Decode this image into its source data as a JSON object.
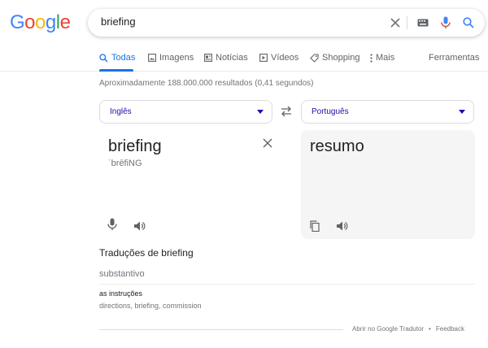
{
  "logo": {
    "letters": [
      "G",
      "o",
      "o",
      "g",
      "l",
      "e"
    ],
    "colors": [
      "#4285F4",
      "#EA4335",
      "#FBBC05",
      "#4285F4",
      "#34A853",
      "#EA4335"
    ]
  },
  "search": {
    "query": "briefing"
  },
  "tabs": [
    {
      "label": "Todas",
      "icon": "search-icon",
      "active": true
    },
    {
      "label": "Imagens",
      "icon": "image-icon",
      "active": false
    },
    {
      "label": "Notícias",
      "icon": "news-icon",
      "active": false
    },
    {
      "label": "Vídeos",
      "icon": "video-icon",
      "active": false
    },
    {
      "label": "Shopping",
      "icon": "tag-icon",
      "active": false
    },
    {
      "label": "Mais",
      "icon": "more-vert-icon",
      "active": false
    }
  ],
  "tools_label": "Ferramentas",
  "stats": "Aproximadamente 188.000.000 resultados (0,41 segundos)",
  "translator": {
    "source_lang": "Inglês",
    "target_lang": "Português",
    "source_word": "briefing",
    "source_phonetic": "ˈbrēfiNG",
    "target_word": "resumo"
  },
  "translations": {
    "heading": "Traduções de briefing",
    "part_of_speech": "substantivo",
    "entries": [
      {
        "word": "as instruções",
        "synonyms": "directions, briefing, commission"
      }
    ]
  },
  "footer": {
    "open_translator": "Abrir no Google Tradutor",
    "separator": "•",
    "feedback": "Feedback"
  },
  "colors": {
    "accent": "#1a73e8",
    "link": "#1a0dab",
    "muted": "#70757a"
  }
}
